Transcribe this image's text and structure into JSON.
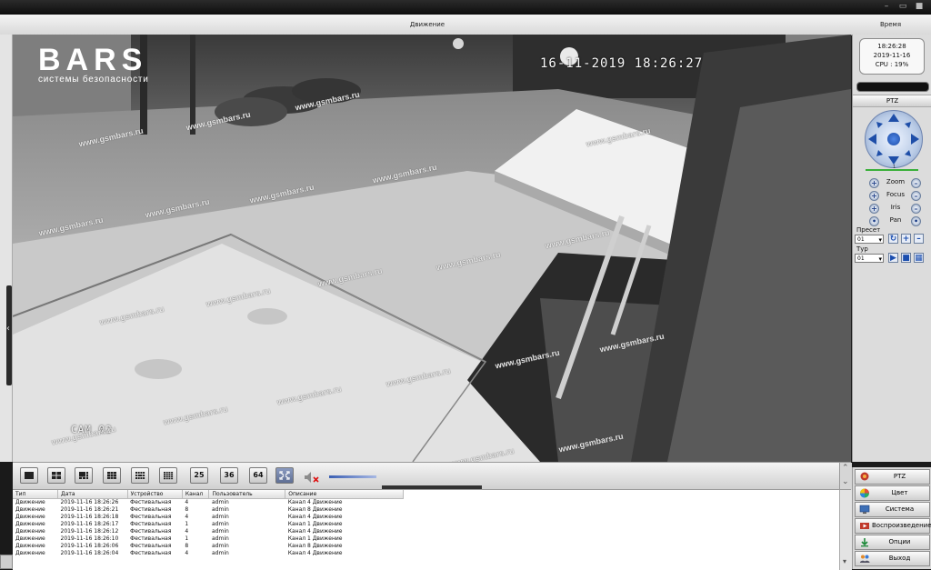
{
  "header": {
    "motion_label": "Движение",
    "time_label": "Время"
  },
  "video": {
    "logo_title": "BARS",
    "logo_subtitle": "системы безопасности",
    "osd_timestamp": "16-11-2019 18:26:27",
    "camera_label": "CAM 02",
    "watermark": "www.gsmbars.ru"
  },
  "clock": {
    "time": "18:26:28",
    "date": "2019-11-16",
    "cpu": "CPU : 19%"
  },
  "ptz": {
    "title": "PTZ",
    "slider_value": "1",
    "controls": [
      "Zoom",
      "Focus",
      "Iris",
      "Pan"
    ],
    "preset_label": "Пресет",
    "preset_value": "01",
    "tour_label": "Тур",
    "tour_value": "01"
  },
  "toolbar": {
    "layouts": [
      "1",
      "4",
      "6",
      "9",
      "12",
      "16",
      "25",
      "36",
      "64"
    ],
    "num_25": "25",
    "num_36": "36",
    "num_64": "64"
  },
  "log": {
    "columns": [
      "Тип",
      "Дата",
      "Устройство",
      "Канал",
      "Пользователь",
      "Описание"
    ],
    "rows": [
      [
        "Движение",
        "2019-11-16 18:26:26",
        "Фестивальная",
        "4",
        "admin",
        "Канал 4 Движение"
      ],
      [
        "Движение",
        "2019-11-16 18:26:21",
        "Фестивальная",
        "8",
        "admin",
        "Канал 8 Движение"
      ],
      [
        "Движение",
        "2019-11-16 18:26:18",
        "Фестивальная",
        "4",
        "admin",
        "Канал 4 Движение"
      ],
      [
        "Движение",
        "2019-11-16 18:26:17",
        "Фестивальная",
        "1",
        "admin",
        "Канал 1 Движение"
      ],
      [
        "Движение",
        "2019-11-16 18:26:12",
        "Фестивальная",
        "4",
        "admin",
        "Канал 4 Движение"
      ],
      [
        "Движение",
        "2019-11-16 18:26:10",
        "Фестивальная",
        "1",
        "admin",
        "Канал 1 Движение"
      ],
      [
        "Движение",
        "2019-11-16 18:26:06",
        "Фестивальная",
        "8",
        "admin",
        "Канал 8 Движение"
      ],
      [
        "Движение",
        "2019-11-16 18:26:04",
        "Фестивальная",
        "4",
        "admin",
        "Канал 4 Движение"
      ]
    ]
  },
  "menu": {
    "ptz": "PTZ",
    "color": "Цвет",
    "system": "Система",
    "playback": "Воспроизведение",
    "options": "Опции",
    "exit": "Выход"
  },
  "colors": {
    "accent_blue": "#1e4ea8",
    "menu_bg": "#d7d7d7"
  }
}
